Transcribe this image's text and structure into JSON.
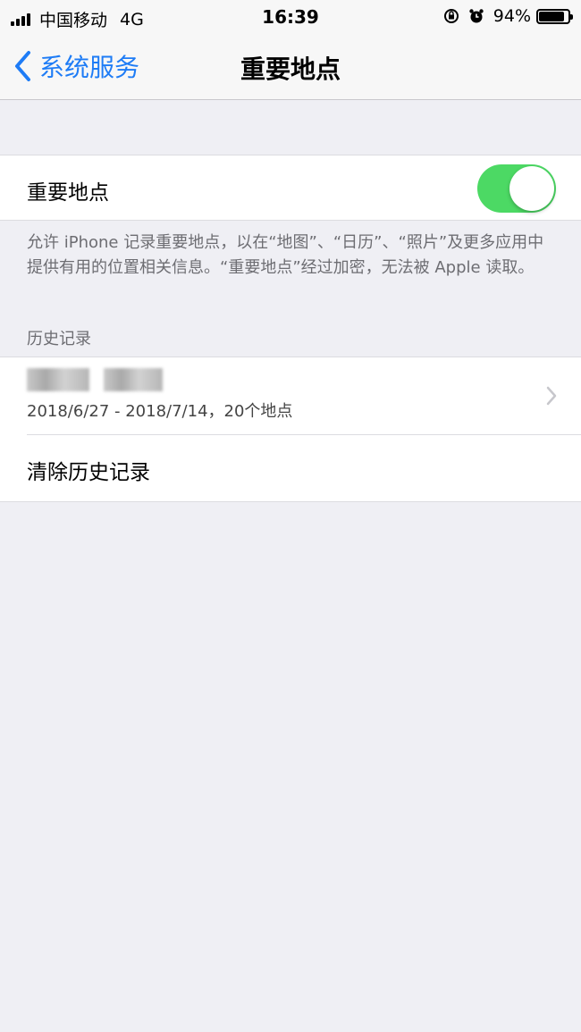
{
  "status_bar": {
    "carrier": "中国移动",
    "network": "4G",
    "time": "16:39",
    "battery_percent": "94%",
    "battery_level": 0.94,
    "icons": [
      "signal-icon",
      "rotation-lock-icon",
      "alarm-icon",
      "battery-icon"
    ]
  },
  "nav": {
    "back_label": "系统服务",
    "title": "重要地点",
    "accent_color": "#1e7cf6"
  },
  "toggle_section": {
    "label": "重要地点",
    "enabled": true,
    "toggle_color": "#4cd964",
    "footer": "允许 iPhone 记录重要地点，以在“地图”、“日历”、“照片”及更多应用中提供有用的位置相关信息。“重要地点”经过加密，无法被 Apple 读取。"
  },
  "history": {
    "header": "历史记录",
    "items": [
      {
        "date_range": "2018/6/27 - 2018/7/14，20个地点"
      }
    ],
    "clear_label": "清除历史记录"
  }
}
